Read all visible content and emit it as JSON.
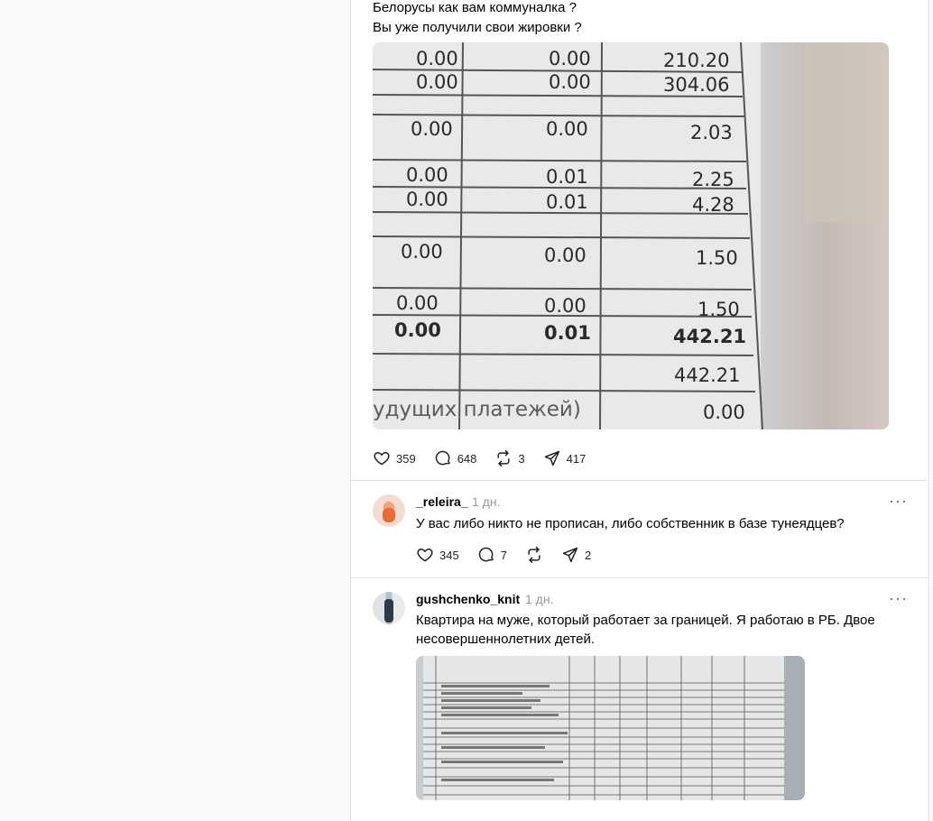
{
  "post": {
    "line1": "Белорусы как вам коммуналка ?",
    "line2": "Вы уже получили свои жировки ?",
    "receipt_rows": [
      {
        "a": "0.00",
        "b": "0.00",
        "c": "210.20"
      },
      {
        "a": "0.00",
        "b": "0.00",
        "c": "304.06"
      },
      {
        "a": "0.00",
        "b": "0.00",
        "c": "2.03"
      },
      {
        "a": "0.00",
        "b": "0.01",
        "c": "2.25"
      },
      {
        "a": "0.00",
        "b": "0.01",
        "c": "4.28"
      },
      {
        "a": "0.00",
        "b": "0.00",
        "c": "1.50"
      },
      {
        "a": "0.00",
        "b": "0.00",
        "c": "1.50"
      },
      {
        "a": "0.00",
        "b": "0.01",
        "c": "442.21"
      }
    ],
    "receipt_total": "442.21",
    "receipt_footer_label": "удущих платежей)",
    "receipt_footer_value": "0.00",
    "likes": "359",
    "comments": "648",
    "reposts": "3",
    "shares": "417"
  },
  "replies": [
    {
      "username": "_releira_",
      "time": "1 дн.",
      "text": "У вас либо никто не прописан, либо собственник в базе тунеядцев?",
      "likes": "345",
      "comments": "7",
      "shares": "2"
    },
    {
      "username": "gushchenko_knit",
      "time": "1 дн.",
      "text_line1": "Квартира на муже, который работает за границей. Я работаю в РБ. Двое",
      "text_line2": "несовершеннолетних детей."
    }
  ],
  "icons": {
    "like": "heart-icon",
    "comment": "speech-bubble-icon",
    "repost": "repost-arrows-icon",
    "share": "paper-plane-icon",
    "more": "ellipsis-icon"
  }
}
